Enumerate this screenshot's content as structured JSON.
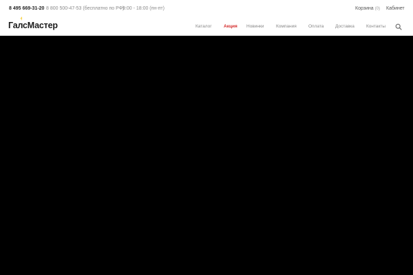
{
  "topbar": {
    "phone_main": "8 495 669-31-20",
    "phone_free": "8 800 500-47-53 (бесплатно по РФ)",
    "hours": "9:00 - 18:00 (пн-пт)",
    "cart_label": "Корзина",
    "cart_count": "(0)",
    "cabinet_label": "Кабинет"
  },
  "logo": {
    "text": "ГалсМастер"
  },
  "nav": {
    "items": [
      {
        "label": "Каталог",
        "active": false
      },
      {
        "label": "Акция",
        "active": true
      },
      {
        "label": "Новинки",
        "active": false
      },
      {
        "label": "Компания",
        "active": false
      },
      {
        "label": "Оплата",
        "active": false
      },
      {
        "label": "Доставка",
        "active": false
      },
      {
        "label": "Контакты",
        "active": false
      }
    ],
    "search_icon": "search-icon"
  },
  "colors": {
    "accent": "#d42b2b",
    "logo_spark": "#f5c518",
    "hero_background": "#000000",
    "header_background": "#ffffff"
  }
}
